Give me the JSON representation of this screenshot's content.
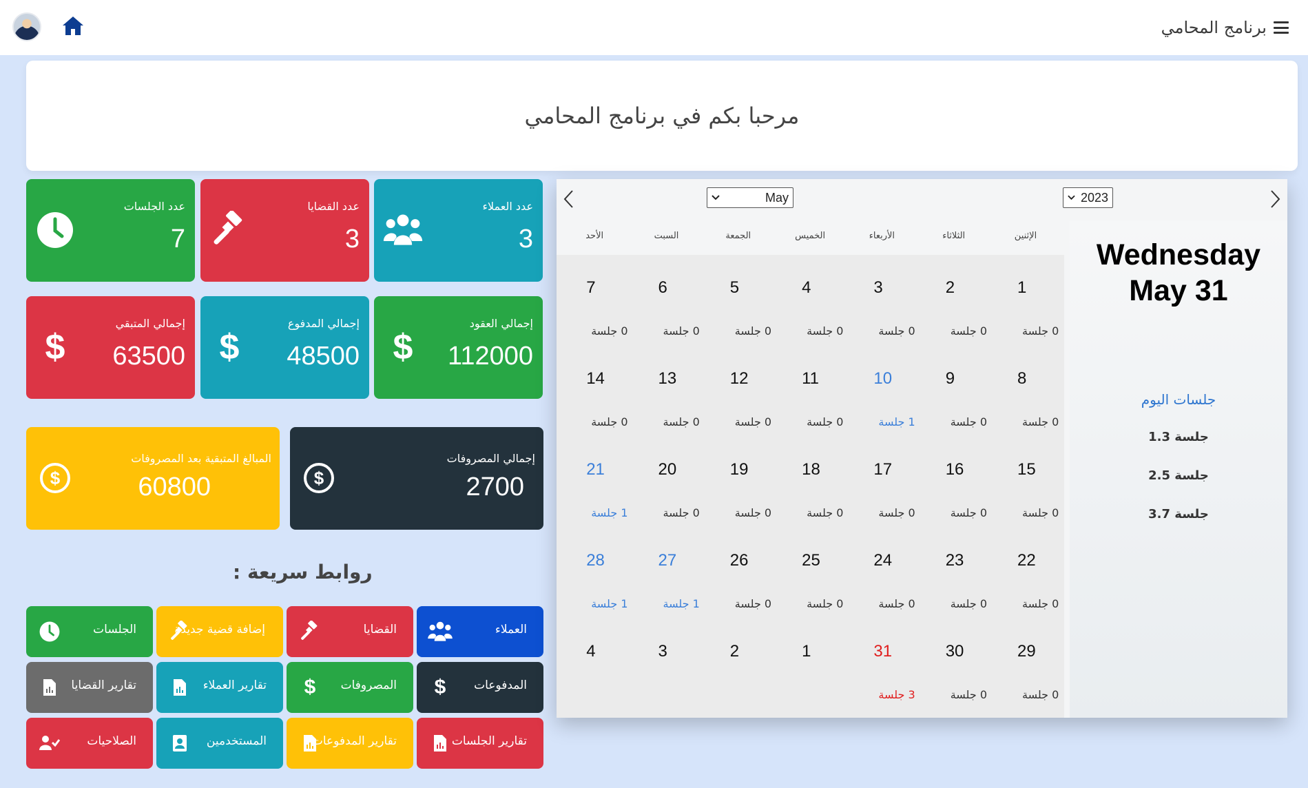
{
  "header": {
    "brand": "برنامج المحامي",
    "menu_icon": "hamburger-icon",
    "home_icon": "home-icon"
  },
  "welcome": "مرحبا بكم في برنامج المحامي",
  "stats": {
    "clients": {
      "title": "عدد العملاء",
      "value": "3",
      "color": "#17a2b8",
      "icon": "users-icon"
    },
    "cases": {
      "title": "عدد القضايا",
      "value": "3",
      "color": "#dc3545",
      "icon": "gavel-icon"
    },
    "sessions": {
      "title": "عدد الجلسات",
      "value": "7",
      "color": "#28a745",
      "icon": "clock-icon"
    },
    "contracts_total": {
      "title": "إجمالي العقود",
      "value": "112000",
      "color": "#28a745",
      "icon": "dollar-icon"
    },
    "paid_total": {
      "title": "إجمالي المدفوع",
      "value": "48500",
      "color": "#17a2b8",
      "icon": "dollar-icon"
    },
    "remaining_total": {
      "title": "إجمالي المتبقي",
      "value": "63500",
      "color": "#dc3545",
      "icon": "dollar-icon"
    },
    "expenses_total": {
      "title": "إجمالي المصروفات",
      "value": "2700",
      "color": "#23323c",
      "icon": "dollar-circle-icon"
    },
    "remaining_after_expenses": {
      "title": "المبالغ المتبقية بعد المصروفات",
      "value": "60800",
      "color": "#ffc107",
      "icon": "dollar-circle-icon"
    }
  },
  "quick_links": {
    "title": "روابط سريعة :",
    "items": [
      {
        "label": "العملاء",
        "color": "#0d50d1",
        "icon": "users-icon"
      },
      {
        "label": "القضايا",
        "color": "#dc3545",
        "icon": "gavel-icon"
      },
      {
        "label": "إضافة قضية جديدة",
        "color": "#ffc107",
        "icon": "gavel-icon"
      },
      {
        "label": "الجلسات",
        "color": "#28a745",
        "icon": "clock-icon"
      },
      {
        "label": "المدفوعات",
        "color": "#23323c",
        "icon": "dollar-icon"
      },
      {
        "label": "المصروفات",
        "color": "#28a745",
        "icon": "dollar-icon"
      },
      {
        "label": "تقارير العملاء",
        "color": "#17a2b8",
        "icon": "report-icon"
      },
      {
        "label": "تقارير القضايا",
        "color": "#6c6c6c",
        "icon": "report-icon"
      },
      {
        "label": "تقارير الجلسات",
        "color": "#dc3545",
        "icon": "report-icon"
      },
      {
        "label": "تقارير المدفوعات",
        "color": "#ffc107",
        "icon": "report-icon"
      },
      {
        "label": "المستخدمين",
        "color": "#17a2b8",
        "icon": "id-card-icon"
      },
      {
        "label": "الصلاحيات",
        "color": "#dc3545",
        "icon": "user-check-icon"
      }
    ]
  },
  "calendar": {
    "month": "May",
    "year": "2023",
    "weekdays": [
      "الإثنين",
      "الثلاثاء",
      "الأربعاء",
      "الخميس",
      "الجمعة",
      "السبت",
      "الأحد"
    ],
    "weeks": [
      [
        {
          "d": "1",
          "c": "0 جلسة"
        },
        {
          "d": "2",
          "c": "0 جلسة"
        },
        {
          "d": "3",
          "c": "0 جلسة"
        },
        {
          "d": "4",
          "c": "0 جلسة"
        },
        {
          "d": "5",
          "c": "0 جلسة"
        },
        {
          "d": "6",
          "c": "0 جلسة"
        },
        {
          "d": "7",
          "c": "0 جلسة"
        }
      ],
      [
        {
          "d": "8",
          "c": "0 جلسة"
        },
        {
          "d": "9",
          "c": "0 جلسة"
        },
        {
          "d": "10",
          "c": "1 جلسة",
          "hl": "blue"
        },
        {
          "d": "11",
          "c": "0 جلسة"
        },
        {
          "d": "12",
          "c": "0 جلسة"
        },
        {
          "d": "13",
          "c": "0 جلسة"
        },
        {
          "d": "14",
          "c": "0 جلسة"
        }
      ],
      [
        {
          "d": "15",
          "c": "0 جلسة"
        },
        {
          "d": "16",
          "c": "0 جلسة"
        },
        {
          "d": "17",
          "c": "0 جلسة"
        },
        {
          "d": "18",
          "c": "0 جلسة"
        },
        {
          "d": "19",
          "c": "0 جلسة"
        },
        {
          "d": "20",
          "c": "0 جلسة"
        },
        {
          "d": "21",
          "c": "1 جلسة",
          "hl": "blue"
        }
      ],
      [
        {
          "d": "22",
          "c": "0 جلسة"
        },
        {
          "d": "23",
          "c": "0 جلسة"
        },
        {
          "d": "24",
          "c": "0 جلسة"
        },
        {
          "d": "25",
          "c": "0 جلسة"
        },
        {
          "d": "26",
          "c": "0 جلسة"
        },
        {
          "d": "27",
          "c": "1 جلسة",
          "hl": "blue"
        },
        {
          "d": "28",
          "c": "1 جلسة",
          "hl": "blue"
        }
      ],
      [
        {
          "d": "29",
          "c": "0 جلسة"
        },
        {
          "d": "30",
          "c": "0 جلسة"
        },
        {
          "d": "31",
          "c": "3 جلسة",
          "hl": "red"
        },
        {
          "d": "1",
          "c": ""
        },
        {
          "d": "2",
          "c": ""
        },
        {
          "d": "3",
          "c": ""
        },
        {
          "d": "4",
          "c": ""
        }
      ]
    ],
    "selected_weekday": "Wednesday",
    "selected_date": "May 31",
    "today_sessions_title": "جلسات اليوم",
    "today_sessions": [
      "1.جلسة 3",
      "2.جلسة 5",
      "3.جلسة 7"
    ]
  }
}
